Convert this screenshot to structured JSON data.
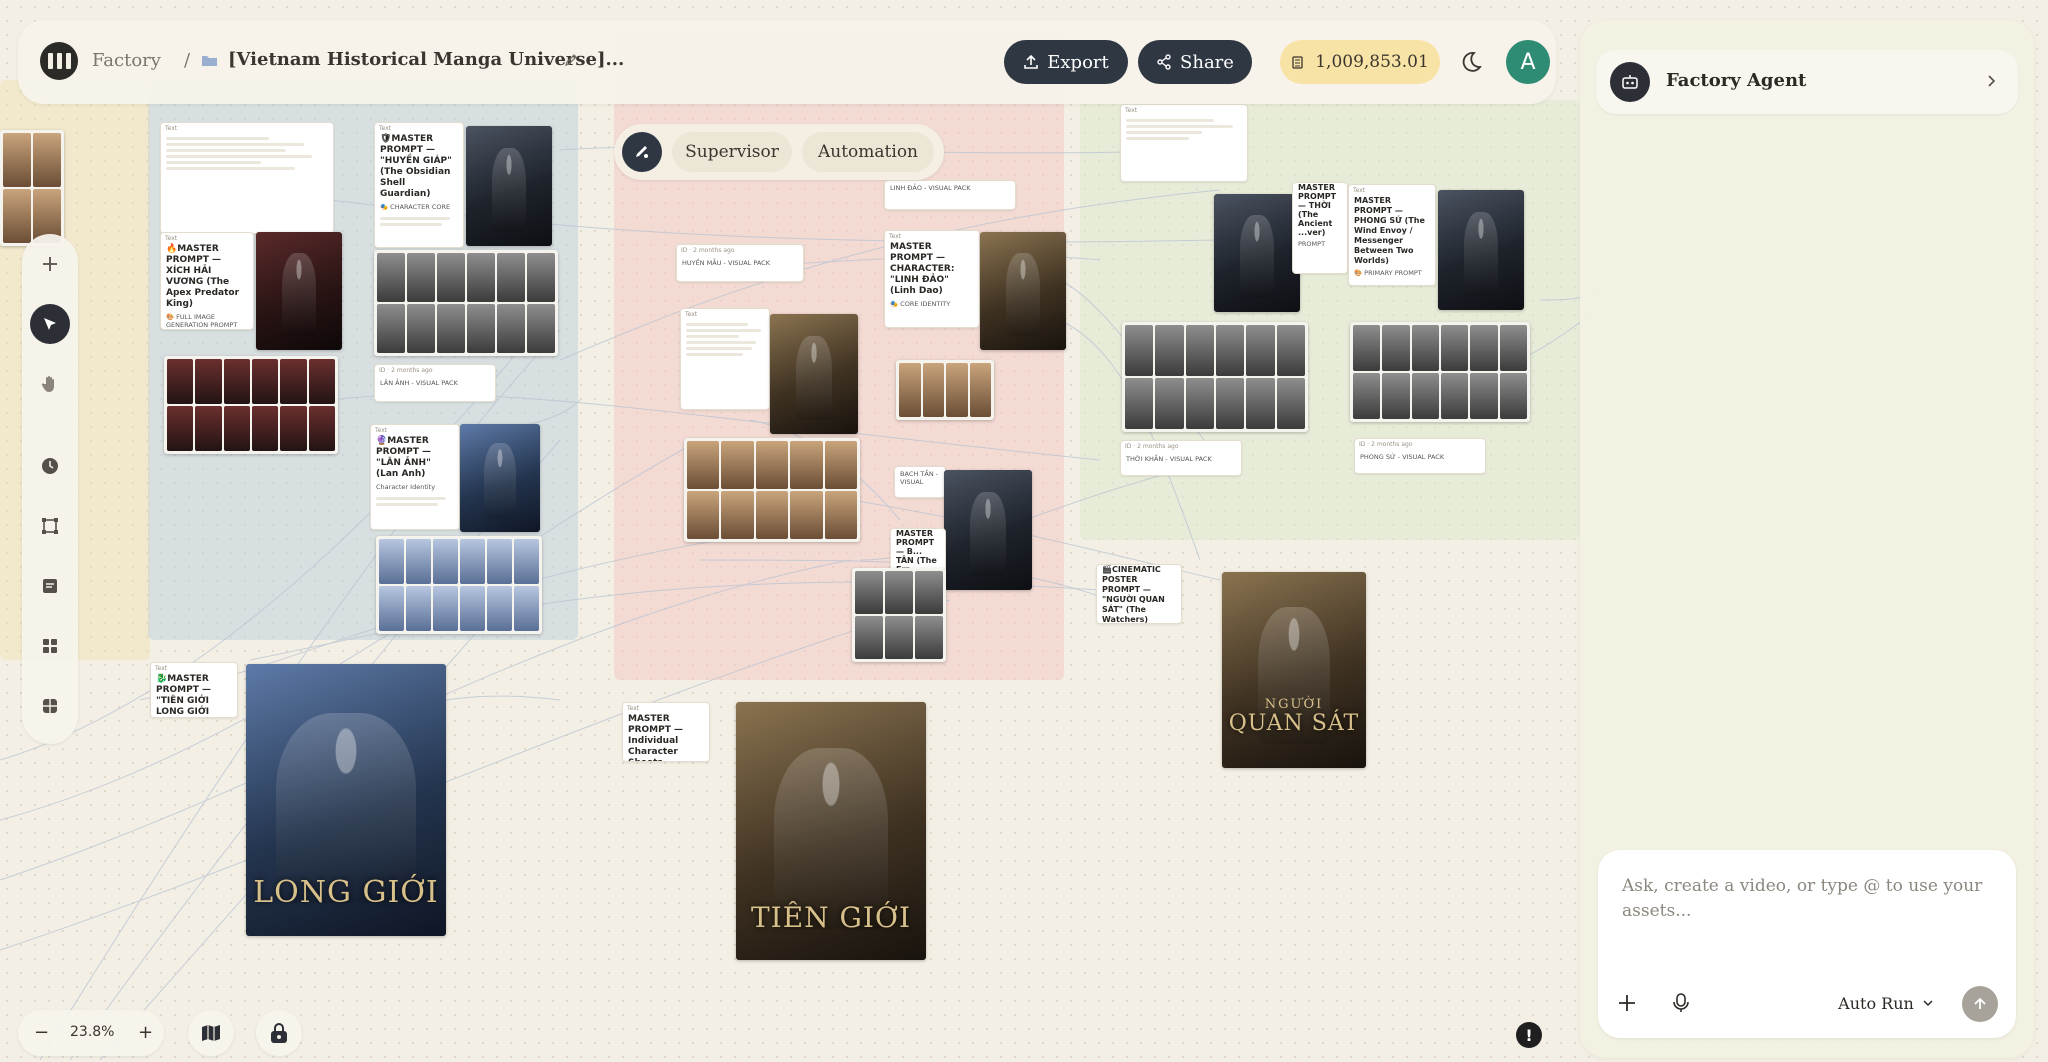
{
  "header": {
    "root_crumb": "Factory",
    "separator": "/",
    "project_name": "[Vietnam Historical Manga Universe]...",
    "export_label": "Export",
    "share_label": "Share",
    "credits": "1,009,853.01",
    "avatar_initial": "A"
  },
  "modes": {
    "supervisor": "Supervisor",
    "automation": "Automation"
  },
  "zoom": {
    "minus": "−",
    "value": "23.8%",
    "plus": "+"
  },
  "agent": {
    "title": "Factory Agent",
    "placeholder": "Ask, create a video, or type @ to use your assets...",
    "run_mode": "Auto Run"
  },
  "canvas": {
    "nodes": {
      "xich_hai_vuong": "🔥MASTER PROMPT — XÍCH HẢI VƯƠNG (The Apex Predator King)",
      "full_image_prompt": "🎨 FULL IMAGE GENERATION PROMPT",
      "huyen_giap": "🛡MASTER PROMPT — \"HUYỀN GIÁP\" (The Obsidian Shell Guardian)",
      "character_core": "🎭 CHARACTER CORE",
      "lan_anh_pack": "LÂN ẢNH - VISUAL PACK",
      "lan_anh": "🔮MASTER PROMPT — \"LÂN ẢNH\" (Lan Anh)",
      "character_identity": "Character Identity",
      "tien_gioi_trinity": "🐉MASTER PROMPT — \"TIÊN GIỚI LONG GIỚI TRINITY\"",
      "huyen_mau_pack": "HUYỀN MẪU - VISUAL PACK",
      "linh_dao_pack": "LINH ĐẢO - VISUAL PACK",
      "linh_dao": "MASTER PROMPT — CHARACTER: \"LINH ĐẢO\" (Linh Dao)",
      "core_identity": "🎭 CORE IDENTITY",
      "bach_tan_pack": "BẠCH TẦN - VISUAL",
      "bach_tan": "MASTER PROMPT — B... TÂN (The Era...",
      "individual_sheets": "MASTER PROMPT — Individual Character Sheets",
      "thoi": "MASTER PROMPT — THỜI (The Ancient ...ver)",
      "primary_prompt_a": "PROMPT",
      "phong_su": "MASTER PROMPT — PHONG SỨ (The Wind Envoy / Messenger Between Two Worlds)",
      "primary_prompt_b": "🎨 PRIMARY PROMPT",
      "thoi_khan_pack": "THỜI KHẮN - VISUAL PACK",
      "phong_su_pack": "PHONG SỨ - VISUAL PACK",
      "cinematic_poster": "🎬CINEMATIC POSTER PROMPT — \"NGƯỜI QUAN SÁT\" (The Watchers)"
    },
    "posters": {
      "long_gioi": "LONG GIỚI",
      "tien_gioi": "TIÊN GIỚI",
      "quan_sat_small": "NGƯỜI",
      "quan_sat": "QUAN SÁT"
    }
  },
  "colors": {
    "canvas_bg": "#f3efe4",
    "dark_button": "#2f3743",
    "credits_bg": "#f7e3a6",
    "avatar_bg": "#2f8c74",
    "group_blue": "#c9d5de",
    "group_red": "#f3c9c4",
    "group_green": "#dfead3"
  },
  "icons": {
    "logo": "factory-logo-icon",
    "export": "upload-icon",
    "share": "share-icon",
    "credits": "coins-icon",
    "theme": "moon-icon",
    "mode": "auto-draw-icon",
    "tools": [
      "plus-icon",
      "cursor-icon",
      "hand-icon",
      "clock-icon",
      "frame-icon",
      "note-icon",
      "grid-icon",
      "layout-icon"
    ],
    "bottom": [
      "map-icon",
      "lock-icon",
      "alert-icon"
    ],
    "agent": [
      "robot-icon",
      "chevron-right-icon",
      "plus-icon",
      "mic-icon",
      "chevron-down-icon",
      "arrow-up-icon"
    ]
  }
}
